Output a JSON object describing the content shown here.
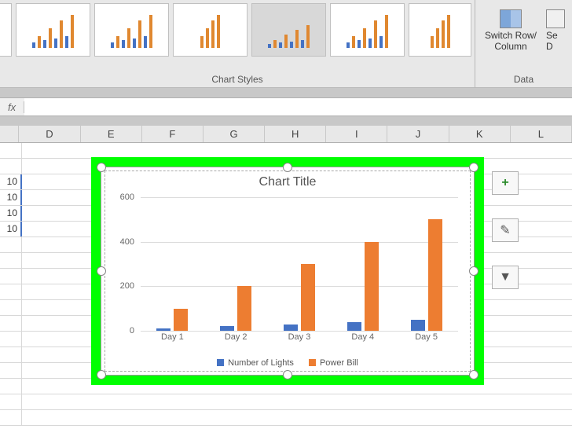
{
  "ribbon": {
    "chart_styles_label": "Chart Styles",
    "data_label": "Data",
    "switch_row_col": "Switch Row/\nColumn",
    "select_data_partial": "Se\nD"
  },
  "formula_bar": {
    "fx": "fx",
    "value": ""
  },
  "columns": [
    "D",
    "E",
    "F",
    "G",
    "H",
    "I",
    "J",
    "K",
    "L"
  ],
  "partial_cells": [
    "10",
    "10",
    "10",
    "10"
  ],
  "chart_data": {
    "type": "bar",
    "title": "Chart Title",
    "categories": [
      "Day 1",
      "Day 2",
      "Day 3",
      "Day 4",
      "Day 5"
    ],
    "series": [
      {
        "name": "Number of Lights",
        "values": [
          10,
          20,
          30,
          40,
          50
        ],
        "color": "#4472c4"
      },
      {
        "name": "Power Bill",
        "values": [
          100,
          200,
          300,
          400,
          500
        ],
        "color": "#ed7d31"
      }
    ],
    "ylim": [
      0,
      600
    ],
    "yticks": [
      0,
      200,
      400,
      600
    ],
    "xlabel": "",
    "ylabel": ""
  },
  "side_tools": {
    "plus": "+",
    "brush": "✎",
    "filter": "▼"
  }
}
